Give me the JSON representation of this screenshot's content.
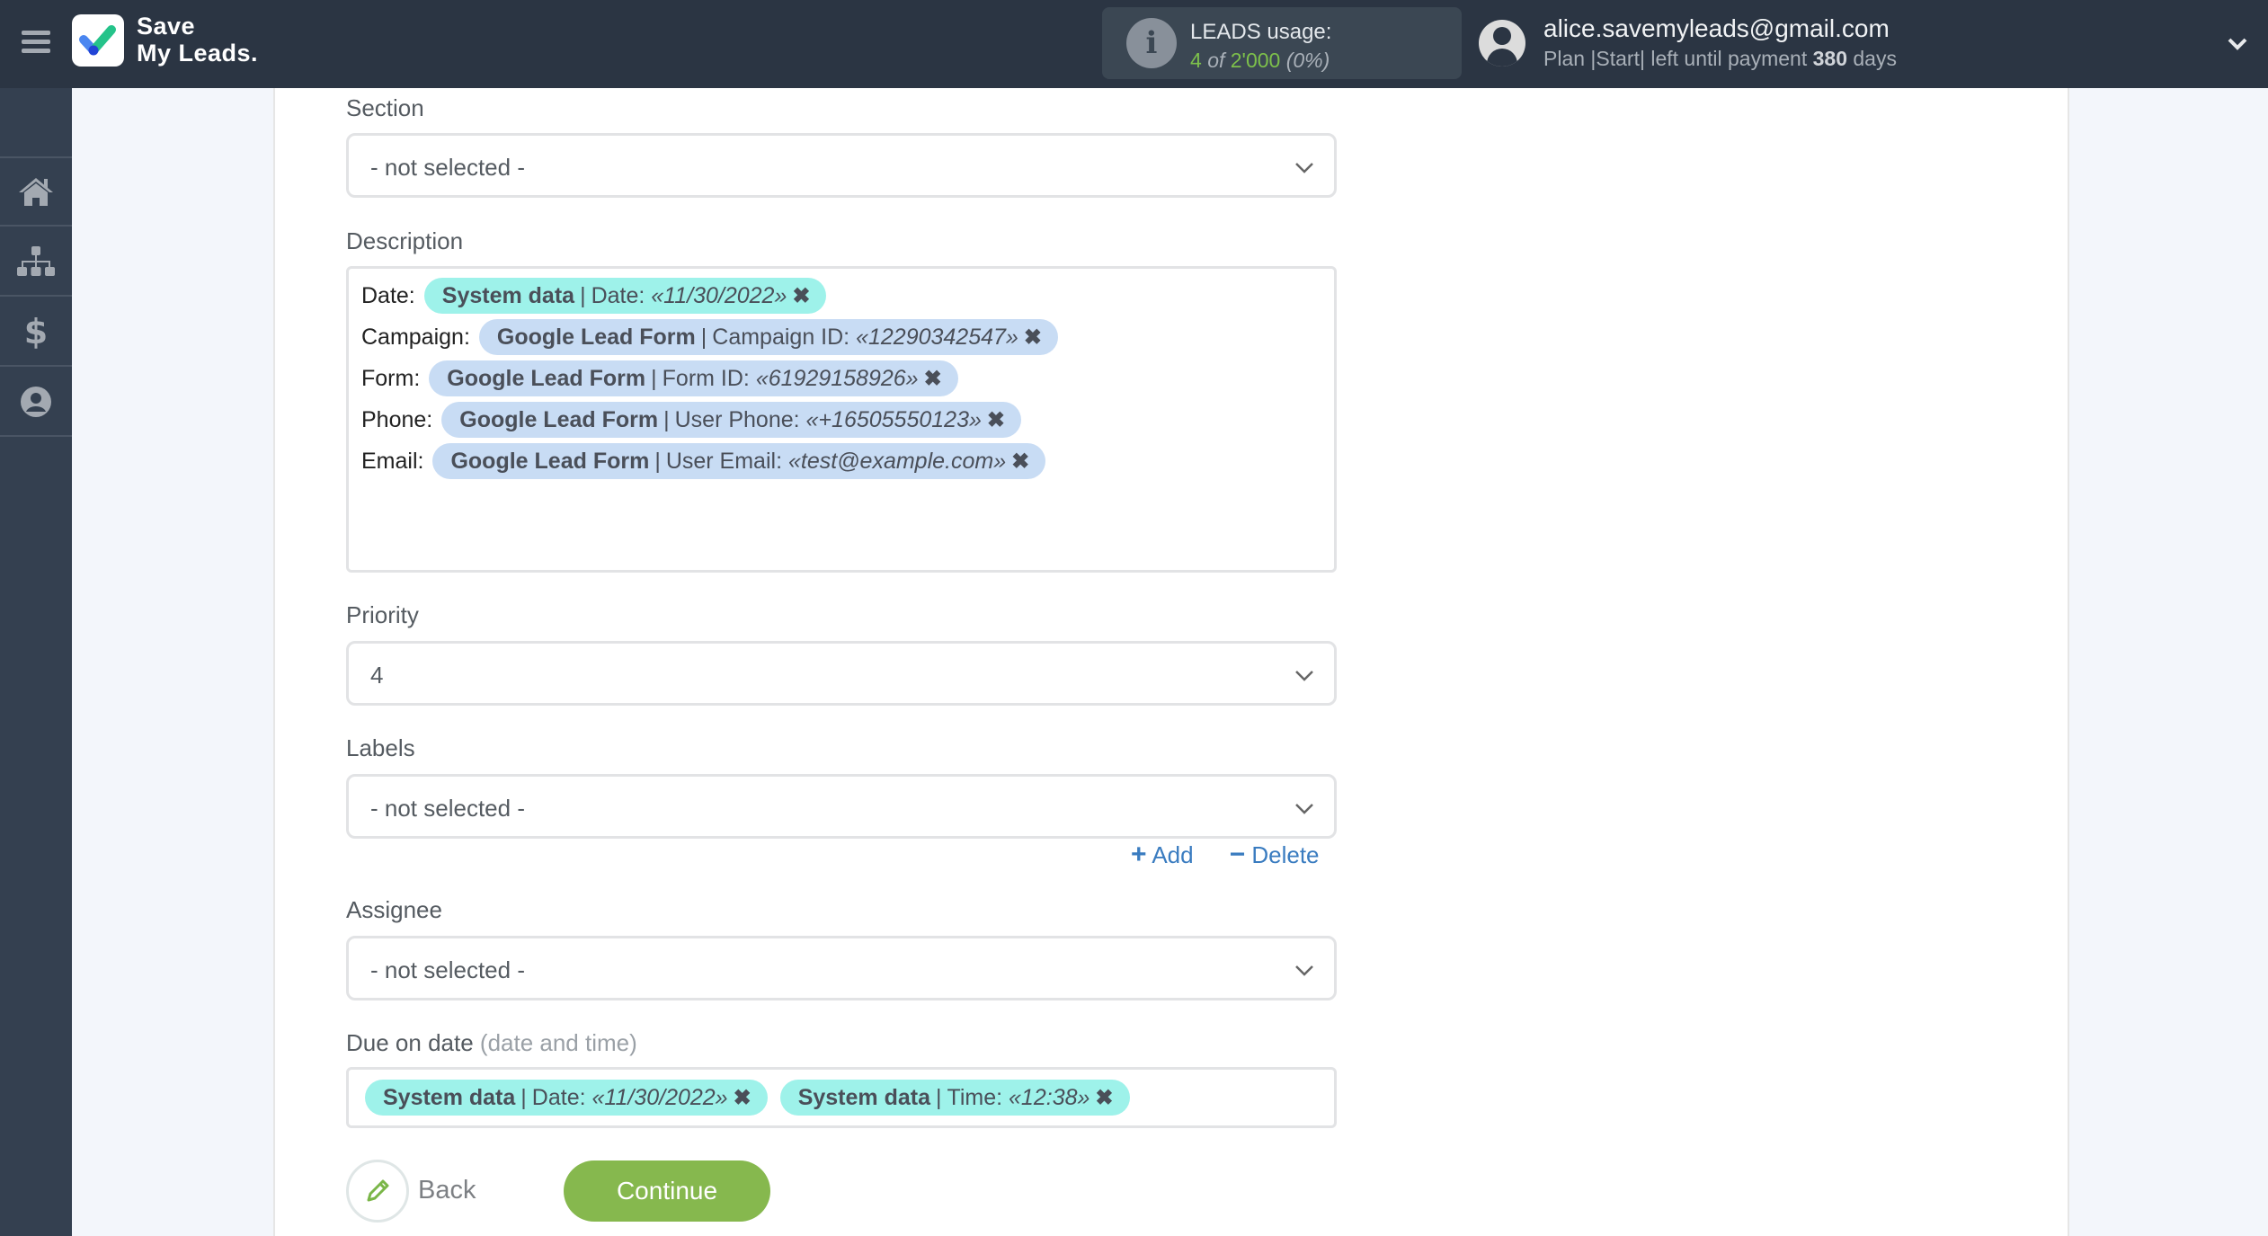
{
  "header": {
    "logo_line1": "Save",
    "logo_line2": "My Leads.",
    "leads_title": "LEADS usage:",
    "leads_used": "4",
    "leads_of": "of",
    "leads_total": "2'000",
    "leads_percent": "(0%)",
    "user_email": "alice.savemyleads@gmail.com",
    "plan_prefix": "Plan |Start| left until payment",
    "plan_days": "380",
    "plan_suffix": "days"
  },
  "sidebar": {
    "items": [
      {
        "name": "home",
        "icon": "home-icon"
      },
      {
        "name": "connections",
        "icon": "sitemap-icon"
      },
      {
        "name": "billing",
        "icon": "dollar-icon"
      },
      {
        "name": "account",
        "icon": "user-circle-icon"
      }
    ]
  },
  "form": {
    "section": {
      "label": "Section",
      "value": "- not selected -"
    },
    "description": {
      "label": "Description",
      "rows": [
        {
          "label": "Date:",
          "chip_type": "sys",
          "source": "System data",
          "field": "Date:",
          "value": "«11/30/2022»"
        },
        {
          "label": "Campaign:",
          "chip_type": "glf",
          "source": "Google Lead Form",
          "field": "Campaign ID:",
          "value": "«12290342547»"
        },
        {
          "label": "Form:",
          "chip_type": "glf",
          "source": "Google Lead Form",
          "field": "Form ID:",
          "value": "«61929158926»"
        },
        {
          "label": "Phone:",
          "chip_type": "glf",
          "source": "Google Lead Form",
          "field": "User Phone:",
          "value": "«+16505550123»"
        },
        {
          "label": "Email:",
          "chip_type": "glf",
          "source": "Google Lead Form",
          "field": "User Email:",
          "value": "«test@example.com»"
        }
      ]
    },
    "priority": {
      "label": "Priority",
      "value": "4"
    },
    "labels": {
      "label": "Labels",
      "value": "- not selected -",
      "add": "Add",
      "delete": "Delete"
    },
    "assignee": {
      "label": "Assignee",
      "value": "- not selected -"
    },
    "due_date": {
      "label": "Due on date",
      "hint": "(date and time)",
      "chips": [
        {
          "source": "System data",
          "field": "Date:",
          "value": "«11/30/2022»"
        },
        {
          "source": "System data",
          "field": "Time:",
          "value": "«12:38»"
        }
      ]
    }
  },
  "actions": {
    "back": "Back",
    "continue": "Continue"
  },
  "colors": {
    "header_bg": "#2b3543",
    "sidebar_bg": "#344050",
    "accent_green": "#86b84e",
    "system_chip": "#9ef2ea",
    "google_chip": "#c8dcf4",
    "link_blue": "#3a7cc0"
  }
}
